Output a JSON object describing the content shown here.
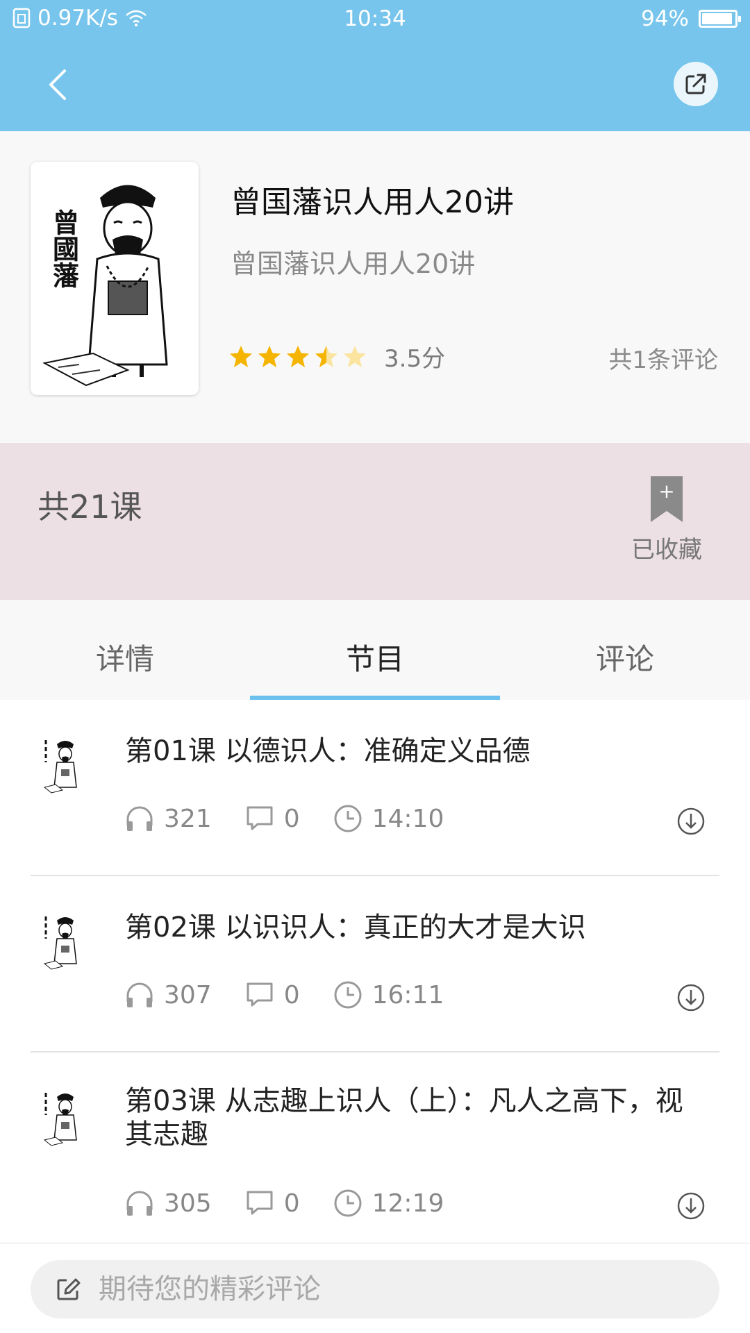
{
  "status_bar": {
    "speed": "0.97K/s",
    "time": "10:34",
    "battery": "94%",
    "battery_level": 0.94
  },
  "header": {
    "title": "曾国藩识人用人20讲",
    "subtitle": "曾国藩识人用人20讲",
    "cover_text": "曾國藩",
    "rating_value": 3.5,
    "score": "3.5分",
    "reviews": "共1条评论"
  },
  "course": {
    "count": "共21课",
    "favorite_label": "已收藏",
    "favorite_icon": "+"
  },
  "tabs": [
    {
      "label": "详情"
    },
    {
      "label": "节目",
      "active": true
    },
    {
      "label": "评论"
    }
  ],
  "lessons": [
    {
      "title": "第01课 以德识人：准确定义品德",
      "plays": "321",
      "comments": "0",
      "duration": "14:10"
    },
    {
      "title": "第02课 以识识人：真正的大才是大识",
      "plays": "307",
      "comments": "0",
      "duration": "16:11"
    },
    {
      "title": "第03课 从志趣上识人（上）：凡人之高下，视其志趣",
      "plays": "305",
      "comments": "0",
      "duration": "12:19"
    }
  ],
  "comment": {
    "placeholder": "期待您的精彩评论"
  },
  "colors": {
    "topbar": "#77c5ec",
    "accent": "#6cc0ee",
    "course_bar": "#ede0e4",
    "star": "#f5b400"
  }
}
